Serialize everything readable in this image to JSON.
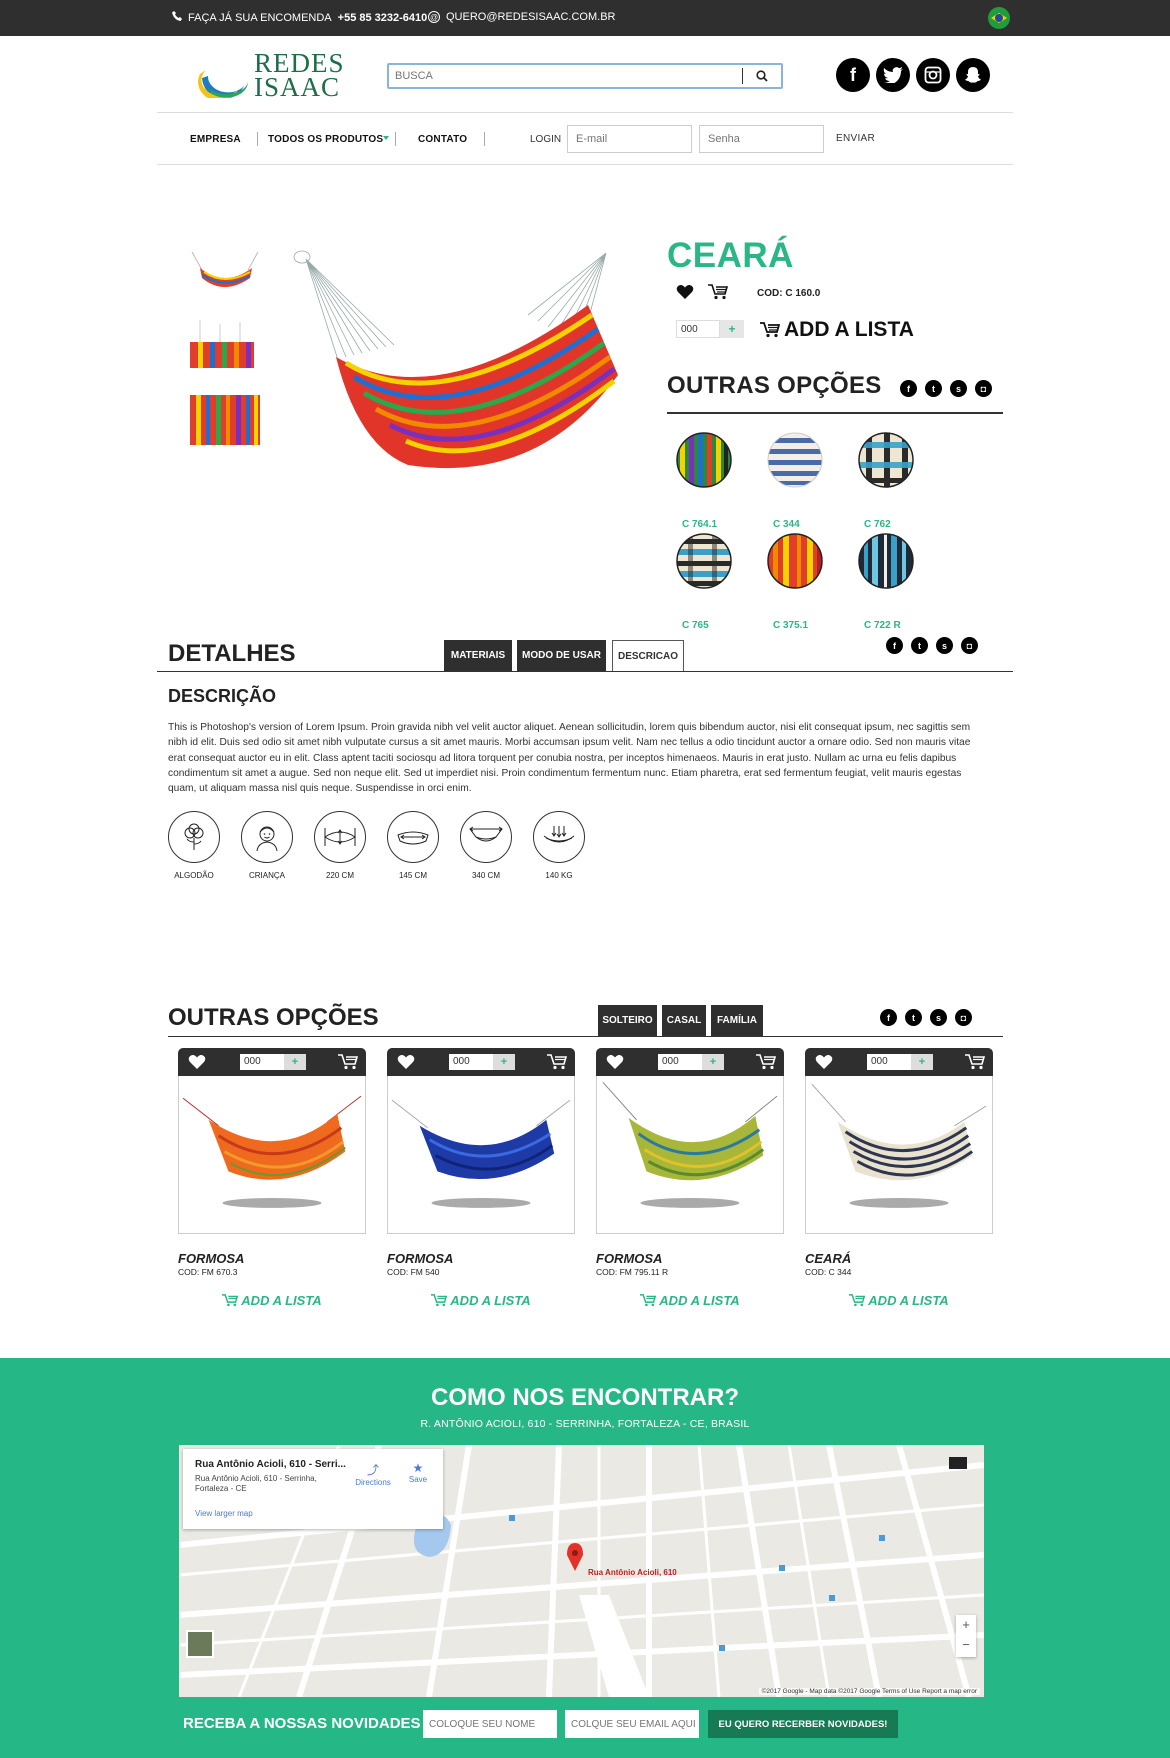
{
  "topbar": {
    "phone_text": "FAÇA JÁ SUA ENCOMENDA",
    "phone_number": "+55 85 3232-6410",
    "email": "QUERO@REDESISAAC.COM.BR"
  },
  "brand": {
    "line1": "REDES",
    "line2": "ISAAC"
  },
  "search": {
    "placeholder": "BUSCA"
  },
  "nav": {
    "items": [
      "EMPRESA",
      "TODOS OS PRODUTOS",
      "CONTATO"
    ],
    "login_label": "LOGIN",
    "email_placeholder": "E-mail",
    "password_placeholder": "Senha",
    "submit": "ENVIAR"
  },
  "product": {
    "title": "CEARÁ",
    "code": "COD: C 160.0",
    "qty": "000",
    "plus": "+",
    "add_label": "ADD A LISTA",
    "other_options_title": "OUTRAS OPÇÕES",
    "options": [
      {
        "code": "C 764.1"
      },
      {
        "code": "C 344"
      },
      {
        "code": "C 762"
      },
      {
        "code": "C 765"
      },
      {
        "code": "C 375.1"
      },
      {
        "code": "C 722 R"
      }
    ]
  },
  "details": {
    "title": "DETALHES",
    "tabs": [
      "MATERIAIS",
      "MODO DE USAR",
      "DESCRICAO"
    ],
    "desc_title": "DESCRIÇÃO",
    "desc_text": "This is Photoshop's version of Lorem Ipsum. Proin gravida nibh vel velit auctor aliquet. Aenean sollicitudin, lorem quis bibendum auctor, nisi elit consequat ipsum, nec sagittis sem nibh id elit. Duis sed odio sit amet nibh vulputate cursus a sit amet mauris. Morbi accumsan ipsum velit. Nam nec tellus a odio tincidunt auctor a ornare odio. Sed non mauris vitae erat consequat auctor eu in elit. Class aptent taciti sociosqu ad litora torquent per conubia nostra, per inceptos himenaeos. Mauris in erat justo. Nullam ac urna eu felis dapibus condimentum sit amet a augue. Sed non neque elit. Sed ut imperdiet nisi. Proin condimentum fermentum nunc. Etiam pharetra, erat sed fermentum feugiat, velit mauris egestas quam, ut aliquam massa nisl quis neque. Suspendisse in orci enim.",
    "features": [
      "ALGODÃO",
      "CRIANÇA",
      "220 CM",
      "145 CM",
      "340 CM",
      "140 KG"
    ]
  },
  "related": {
    "title": "OUTRAS OPÇÕES",
    "tabs": [
      "SOLTEIRO",
      "CASAL",
      "FAMÍLIA"
    ],
    "items": [
      {
        "name": "FORMOSA",
        "code": "COD: FM 670.3",
        "qty": "000",
        "add": "ADD A LISTA"
      },
      {
        "name": "FORMOSA",
        "code": "COD: FM 540",
        "qty": "000",
        "add": "ADD A LISTA"
      },
      {
        "name": "FORMOSA",
        "code": "COD: FM 795.11 R",
        "qty": "000",
        "add": "ADD A LISTA"
      },
      {
        "name": "CEARÁ",
        "code": "COD: C 344",
        "qty": "000",
        "add": "ADD A LISTA"
      }
    ]
  },
  "footer": {
    "title": "COMO NOS ENCONTRAR?",
    "address": "R. ANTÔNIO ACIOLI, 610 - SERRINHA, FORTALEZA - CE, BRASIL",
    "map": {
      "info_title": "Rua Antônio Acioli, 610 - Serri...",
      "info_address": "Rua Antônio Acioli, 610 - Serrinha, Fortaleza - CE",
      "directions": "Directions",
      "save": "Save",
      "larger": "View larger map",
      "pin_label": "Rua Antônio Acioli, 610",
      "attribution": "©2017 Google - Map data ©2017 Google   Terms of Use   Report a map error",
      "zoom_in": "+",
      "zoom_out": "−"
    },
    "newsletter": {
      "title": "RECEBA A NOSSAS NOVIDADES",
      "name_placeholder": "COLOQUE SEU NOME",
      "email_placeholder": "COLQUE SEU EMAIL AQUI",
      "button": "EU QUERO RECERBER NOVIDADES!"
    }
  },
  "colors": {
    "accent": "#26b786",
    "dark": "#2f2f2f"
  }
}
